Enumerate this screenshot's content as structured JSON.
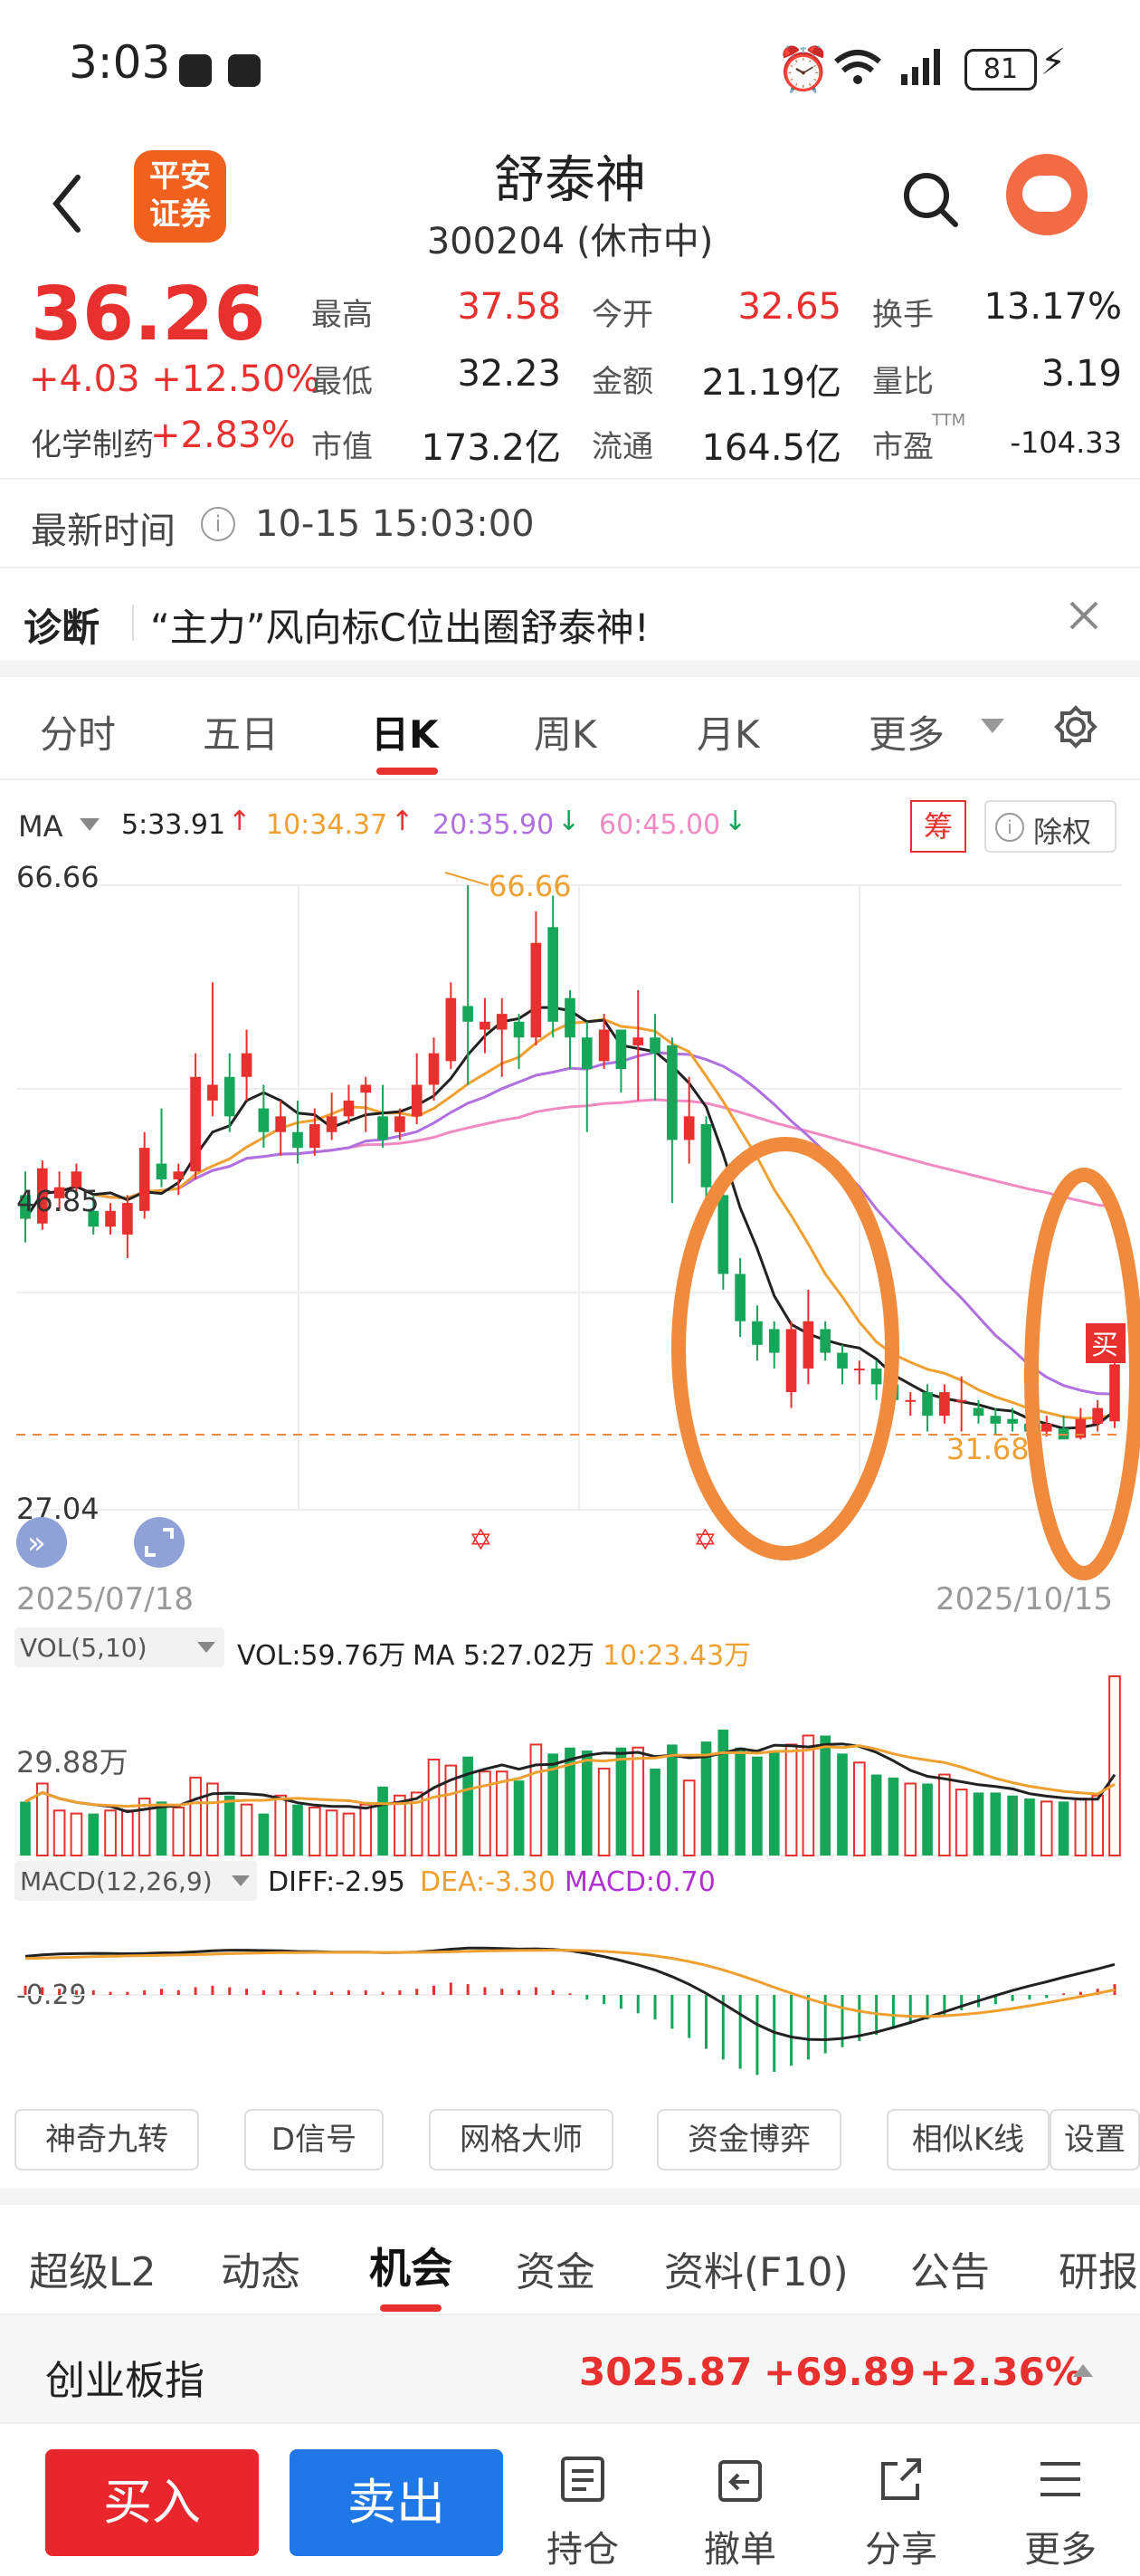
{
  "status_bar": {
    "time": "3:03",
    "battery": "81"
  },
  "header": {
    "logo_text_1": "平安",
    "logo_text_2": "证券",
    "title": "舒泰神",
    "subtitle": "300204 (休市中)"
  },
  "quote": {
    "price": "36.26",
    "change": "+4.03 +12.50%",
    "sector": "化学制药",
    "sector_change": "+2.83%",
    "high_label": "最高",
    "high": "37.58",
    "low_label": "最低",
    "low": "32.23",
    "mcap_label": "市值",
    "mcap": "173.2亿",
    "open_label": "今开",
    "open": "32.65",
    "amount_label": "金额",
    "amount": "21.19亿",
    "float_label": "流通",
    "float": "164.5亿",
    "turnover_label": "换手",
    "turnover": "13.17%",
    "vol_ratio_label": "量比",
    "vol_ratio": "3.19",
    "pe_label": "市盈",
    "pe_sup": "TTM",
    "pe": "-104.33"
  },
  "update": {
    "label": "最新时间",
    "value": "10-15 15:03:00"
  },
  "diagnosis": {
    "label": "诊断",
    "text": "“主力”风向标C位出圈舒泰神!"
  },
  "chart_tabs": [
    "分时",
    "五日",
    "日K",
    "周K",
    "月K",
    "更多"
  ],
  "ma_legend": {
    "label": "MA",
    "ma5": "5:33.91",
    "ma10": "10:34.37",
    "ma20": "20:35.90",
    "ma60": "60:45.00",
    "chip": "筹",
    "adjust": "除权"
  },
  "candle_axis": {
    "top": "66.66",
    "mid": "46.85",
    "bottom": "27.04",
    "peak_label": "66.66",
    "low_label": "31.68",
    "buy_marker": "买",
    "start_date": "2025/07/18",
    "end_date": "2025/10/15"
  },
  "vol_legend": {
    "label": "VOL(5,10)",
    "vol": "VOL:59.76万",
    "ma5": "MA 5:27.02万",
    "ma10": "10:23.43万",
    "axis": "29.88万"
  },
  "macd_legend": {
    "label": "MACD(12,26,9)",
    "diff": "DIFF:-2.95",
    "dea": "DEA:-3.30",
    "macd": "MACD:0.70",
    "axis": "-0.29"
  },
  "tools": [
    "神奇九转",
    "D信号",
    "网格大师",
    "资金博弈",
    "相似K线",
    "设置"
  ],
  "bottom_tabs": [
    "超级L2",
    "动态",
    "机会",
    "资金",
    "资料(F10)",
    "公告",
    "研报"
  ],
  "index_ticker": {
    "name": "创业板指",
    "value": "3025.87",
    "change": "+69.89",
    "pct": "+2.36%"
  },
  "action_bar": {
    "buy": "买入",
    "sell": "卖出",
    "items": [
      "持仓",
      "撤单",
      "分享",
      "更多"
    ]
  },
  "colors": {
    "up": "#e8312f",
    "down": "#15a65a",
    "ma5": "#222222",
    "ma10": "#f0a030",
    "ma20": "#b070e0",
    "ma60": "#f08ac0",
    "annotation": "#f08a3c"
  },
  "chart_data": {
    "type": "candlestick",
    "ylim": [
      27.04,
      66.66
    ],
    "candles": [
      [
        47.0,
        45.5,
        48.5,
        44.0
      ],
      [
        45.2,
        48.7,
        49.2,
        44.8
      ],
      [
        46.8,
        47.5,
        48.5,
        46.0
      ],
      [
        47.5,
        48.5,
        49.0,
        47.0
      ],
      [
        46.0,
        45.0,
        47.0,
        44.5
      ],
      [
        45.0,
        46.0,
        46.5,
        44.5
      ],
      [
        44.5,
        46.5,
        47.0,
        43.0
      ],
      [
        46.0,
        50.0,
        51.0,
        45.5
      ],
      [
        49.0,
        48.0,
        52.5,
        47.5
      ],
      [
        48.0,
        48.5,
        49.0,
        47.0
      ],
      [
        48.5,
        54.5,
        56.0,
        48.0
      ],
      [
        53.0,
        54.0,
        60.5,
        52.0
      ],
      [
        54.5,
        52.0,
        56.0,
        51.0
      ],
      [
        54.5,
        56.0,
        57.5,
        53.0
      ],
      [
        52.5,
        51.0,
        54.0,
        50.0
      ],
      [
        51.0,
        52.0,
        53.0,
        49.5
      ],
      [
        51.0,
        50.0,
        53.0,
        49.0
      ],
      [
        50.0,
        51.5,
        52.5,
        49.5
      ],
      [
        51.0,
        52.0,
        53.5,
        50.5
      ],
      [
        52.0,
        53.0,
        54.0,
        51.5
      ],
      [
        53.5,
        54.0,
        54.5,
        51.0
      ],
      [
        52.0,
        50.5,
        54.0,
        50.0
      ],
      [
        51.0,
        52.0,
        52.5,
        50.5
      ],
      [
        52.0,
        54.0,
        56.0,
        51.5
      ],
      [
        54.0,
        56.0,
        57.0,
        53.0
      ],
      [
        55.5,
        59.5,
        60.5,
        55.0
      ],
      [
        59.0,
        58.0,
        66.66,
        54.0
      ],
      [
        57.5,
        58.0,
        59.5,
        56.0
      ],
      [
        57.5,
        58.5,
        59.5,
        54.5
      ],
      [
        58.0,
        57.0,
        58.5,
        55.0
      ],
      [
        57.0,
        63.0,
        65.0,
        56.5
      ],
      [
        64.0,
        58.0,
        66.0,
        57.0
      ],
      [
        59.5,
        57.0,
        60.0,
        55.0
      ],
      [
        57.0,
        55.0,
        58.0,
        51.0
      ],
      [
        55.5,
        57.5,
        58.5,
        55.0
      ],
      [
        57.5,
        55.0,
        57.5,
        53.5
      ],
      [
        56.5,
        57.0,
        60.0,
        53.0
      ],
      [
        57.0,
        56.0,
        58.5,
        53.0
      ],
      [
        56.5,
        50.5,
        57.0,
        46.5
      ],
      [
        50.5,
        52.0,
        54.5,
        49.0
      ],
      [
        51.5,
        47.5,
        52.0,
        46.5
      ],
      [
        47.0,
        42.0,
        47.5,
        41.0
      ],
      [
        42.0,
        39.0,
        43.0,
        38.0
      ],
      [
        39.0,
        37.5,
        40.0,
        36.5
      ],
      [
        38.5,
        37.0,
        39.0,
        36.0
      ],
      [
        34.5,
        38.5,
        39.0,
        33.5
      ],
      [
        36.0,
        39.0,
        41.0,
        35.0
      ],
      [
        38.5,
        37.0,
        39.0,
        36.5
      ],
      [
        37.0,
        36.0,
        37.5,
        35.0
      ],
      [
        36.0,
        36.0,
        36.5,
        35.0
      ],
      [
        36.0,
        35.0,
        36.5,
        34.0
      ],
      [
        35.0,
        34.0,
        35.5,
        33.5
      ],
      [
        34.0,
        34.0,
        34.5,
        33.0
      ],
      [
        34.5,
        33.0,
        35.0,
        32.0
      ],
      [
        33.0,
        34.5,
        35.0,
        32.5
      ],
      [
        34.0,
        34.0,
        35.5,
        32.0
      ],
      [
        33.5,
        33.0,
        34.0,
        32.5
      ],
      [
        33.0,
        32.5,
        33.5,
        31.8
      ],
      [
        32.8,
        32.5,
        33.5,
        32.0
      ],
      [
        32.5,
        32.0,
        33.0,
        31.5
      ],
      [
        32.0,
        32.5,
        33.0,
        31.68
      ],
      [
        32.2,
        31.5,
        33.0,
        31.68
      ],
      [
        31.6,
        32.8,
        33.5,
        31.5
      ],
      [
        32.5,
        33.5,
        34.0,
        32.0
      ],
      [
        32.65,
        36.26,
        37.58,
        32.23
      ]
    ],
    "volumes": [
      18,
      24,
      15,
      14,
      14,
      15,
      15,
      19,
      18,
      16,
      26,
      24,
      20,
      17,
      14,
      20,
      17,
      16,
      15,
      14,
      17,
      23,
      20,
      21,
      32,
      30,
      33,
      28,
      28,
      25,
      37,
      34,
      36,
      35,
      29,
      36,
      36,
      29,
      37,
      25,
      38,
      42,
      36,
      33,
      35,
      37,
      40,
      40,
      34,
      31,
      27,
      26,
      24,
      24,
      27,
      22,
      21,
      21,
      20,
      19,
      18,
      18,
      19,
      20,
      59.76
    ],
    "macd": [
      0.6,
      0.5,
      0.4,
      0.3,
      0.3,
      0.2,
      0.2,
      0.3,
      0.4,
      0.3,
      0.5,
      0.6,
      0.5,
      0.4,
      0.3,
      0.3,
      0.2,
      0.3,
      0.2,
      0.3,
      0.3,
      0.2,
      0.3,
      0.4,
      0.6,
      0.8,
      0.7,
      0.5,
      0.4,
      0.3,
      0.5,
      0.3,
      0.1,
      -0.3,
      -0.6,
      -0.9,
      -1.2,
      -1.6,
      -2.2,
      -2.8,
      -3.5,
      -4.2,
      -4.8,
      -5.2,
      -5.0,
      -4.6,
      -4.2,
      -3.8,
      -3.4,
      -3.0,
      -2.6,
      -2.2,
      -1.9,
      -1.6,
      -1.3,
      -1.0,
      -0.8,
      -0.6,
      -0.4,
      -0.3,
      -0.2,
      0.1,
      0.2,
      0.4,
      0.7
    ]
  }
}
